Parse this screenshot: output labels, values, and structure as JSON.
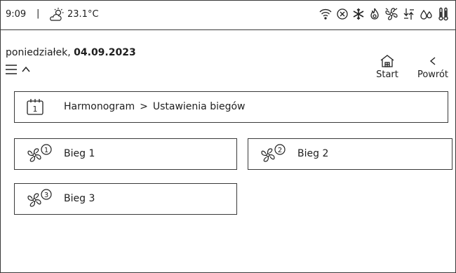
{
  "status": {
    "time": "9:09",
    "separator": "|",
    "temperature": "23.1°C"
  },
  "status_icons": [
    "wifi-icon",
    "no-connection-icon",
    "snowflake-icon",
    "flame-icon",
    "fan-alert-icon",
    "pump-icon",
    "water-drops-icon",
    "thermometer-icon"
  ],
  "header": {
    "date_prefix": "poniedziałek, ",
    "date": "04.09.2023"
  },
  "nav": {
    "start": "Start",
    "back": "Powrót"
  },
  "breadcrumb": {
    "calendar_day": "1",
    "path_root": "Harmonogram",
    "arrow": ">",
    "path_current": "Ustawienia biegów"
  },
  "gears": [
    {
      "label": "Bieg 1",
      "number": "1"
    },
    {
      "label": "Bieg 2",
      "number": "2"
    },
    {
      "label": "Bieg 3",
      "number": "3"
    }
  ]
}
